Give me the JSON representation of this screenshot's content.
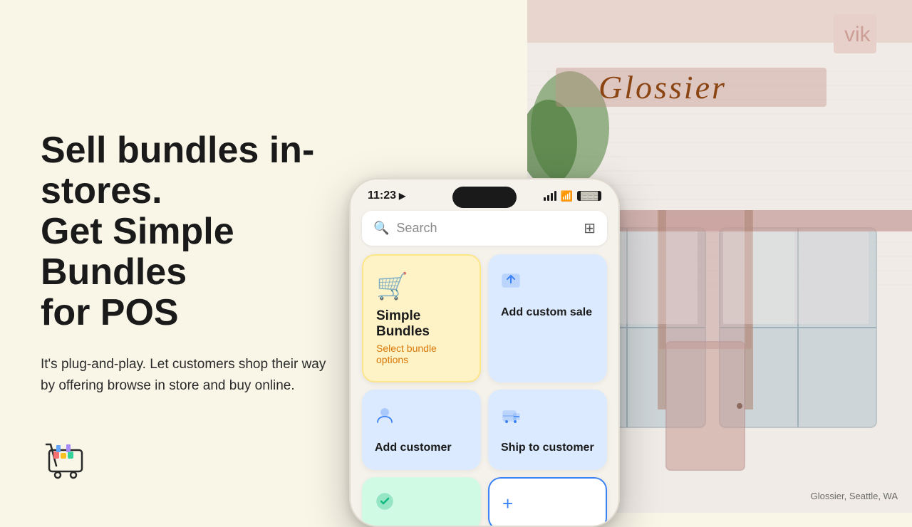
{
  "page": {
    "background_color": "#f9f6e8"
  },
  "left": {
    "heading_line1": "Sell bundles in-stores.",
    "heading_line2": "Get Simple Bundles",
    "heading_line3": "for POS",
    "subtext": "It's plug-and-play. Let customers shop their way by offering browse in store and buy online."
  },
  "phone": {
    "status_bar": {
      "time": "11:23",
      "nav_icon": "▶"
    },
    "search": {
      "placeholder": "Search"
    },
    "tiles": [
      {
        "id": "simple-bundles",
        "title": "Simple Bundles",
        "subtitle": "Select bundle options",
        "icon": "🛒",
        "style": "yellow"
      },
      {
        "id": "add-custom-sale",
        "title": "Add custom sale",
        "icon": "⬆",
        "style": "blue"
      },
      {
        "id": "add-customer",
        "title": "Add customer",
        "icon": "👤",
        "style": "blue"
      },
      {
        "id": "ship-to-customer",
        "title": "Ship to customer",
        "icon": "📦",
        "style": "blue"
      },
      {
        "id": "tile-green",
        "icon": "🔄",
        "style": "mint"
      },
      {
        "id": "tile-plus",
        "icon": "+",
        "style": "white-bordered"
      }
    ]
  },
  "attribution": {
    "text": "Glossier, Seattle, WA"
  },
  "store": {
    "name": "Glossier"
  }
}
